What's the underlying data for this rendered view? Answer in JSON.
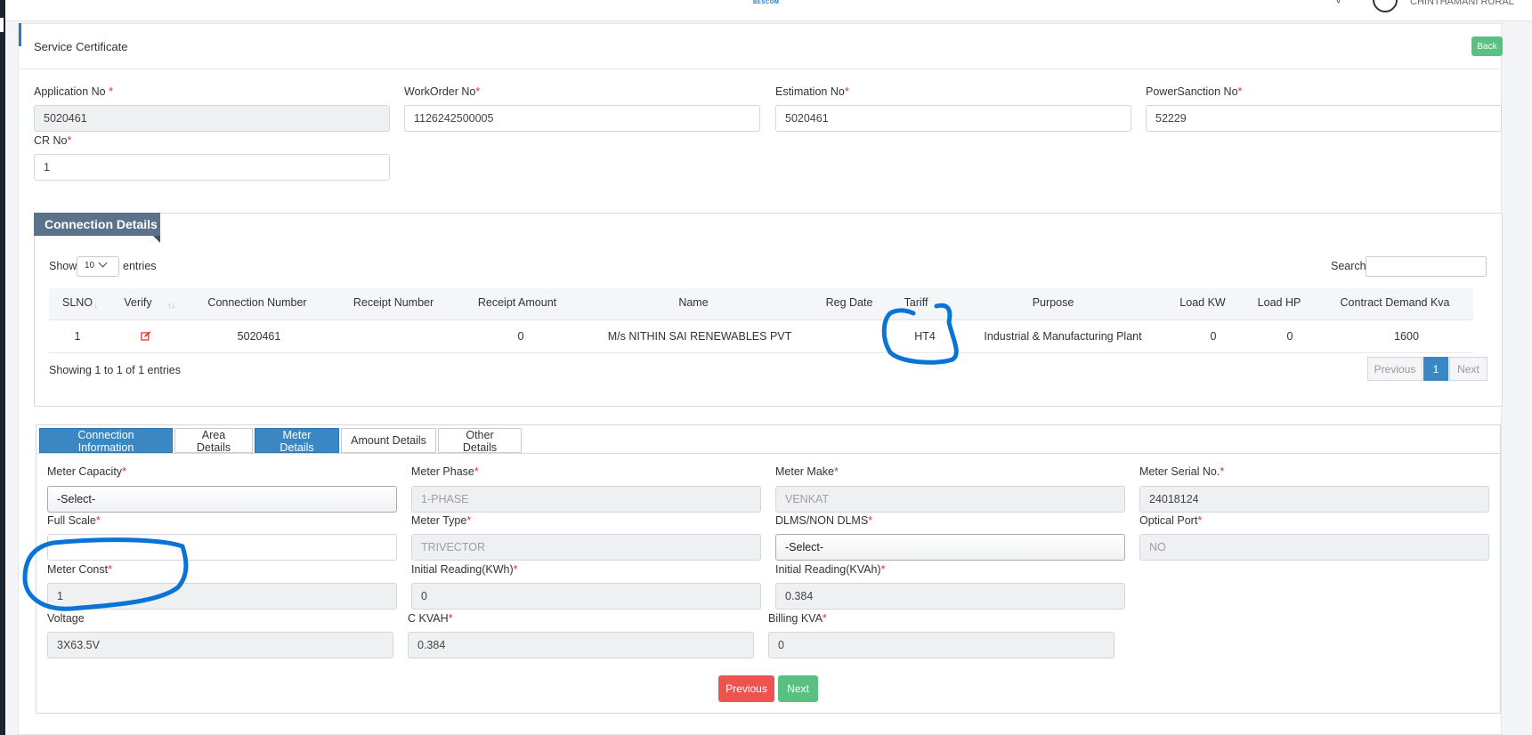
{
  "header": {
    "logo_text": "BESCOM",
    "user_name": "CHINTHAMANI RURAL"
  },
  "page": {
    "title": "Service Certificate",
    "back_label": "Back"
  },
  "form": {
    "application_no": {
      "label": "Application No",
      "required": "*",
      "value": "5020461"
    },
    "workorder_no": {
      "label": "WorkOrder No",
      "required": "*",
      "value": "1126242500005"
    },
    "estimation_no": {
      "label": "Estimation No",
      "required": "*",
      "value": "5020461"
    },
    "powersanction_no": {
      "label": "PowerSanction No",
      "required": "*",
      "value": "52229"
    },
    "cr_no": {
      "label": "CR No",
      "required": "*",
      "value": "1"
    }
  },
  "connection_details": {
    "heading": "Connection Details",
    "show_label": "Show",
    "entries_value": "10",
    "entries_label": "entries",
    "search_label": "Search:",
    "columns": [
      "SLNO",
      "Verify",
      "Connection Number",
      "Receipt Number",
      "Receipt Amount",
      "Name",
      "Reg Date",
      "Tariff",
      "Purpose",
      "Load KW",
      "Load HP",
      "Contract Demand Kva"
    ],
    "rows": [
      {
        "slno": "1",
        "connection_number": "5020461",
        "receipt_number": "",
        "receipt_amount": "0",
        "name": "M/s NITHIN SAI RENEWABLES PVT",
        "reg_date": "",
        "tariff": "HT4",
        "purpose": "Industrial & Manufacturing Plant",
        "load_kw": "0",
        "load_hp": "0",
        "contract_demand": "1600"
      }
    ],
    "showing": "Showing 1 to 1 of 1 entries",
    "pager": {
      "previous": "Previous",
      "page": "1",
      "next": "Next"
    }
  },
  "tabs": [
    "Connection Information",
    "Area Details",
    "Meter Details",
    "Amount Details",
    "Other Details"
  ],
  "meter": {
    "meter_capacity": {
      "label": "Meter Capacity",
      "required": "*",
      "value": "-Select-"
    },
    "meter_phase": {
      "label": "Meter Phase",
      "required": "*",
      "value": "1-PHASE"
    },
    "meter_make": {
      "label": "Meter Make",
      "required": "*",
      "value": "VENKAT"
    },
    "meter_serial": {
      "label": "Meter Serial No.",
      "required": "*",
      "value": "24018124"
    },
    "full_scale": {
      "label": "Full Scale",
      "required": "*",
      "value": ""
    },
    "meter_type": {
      "label": "Meter Type",
      "required": "*",
      "value": "TRIVECTOR"
    },
    "dlms": {
      "label": "DLMS/NON DLMS",
      "required": "*",
      "value": "-Select-"
    },
    "optical_port": {
      "label": "Optical Port",
      "required": "*",
      "value": "NO"
    },
    "meter_const": {
      "label": "Meter Const",
      "required": "*",
      "value": "1"
    },
    "initial_kwh": {
      "label": "Initial Reading(KWh)",
      "required": "*",
      "value": "0"
    },
    "initial_kvah": {
      "label": "Initial Reading(KVAh)",
      "required": "*",
      "value": "0.384"
    },
    "voltage": {
      "label": "Voltage",
      "required": "",
      "value": "3X63.5V"
    },
    "c_kvah": {
      "label": "C KVAH",
      "required": "*",
      "value": "0.384"
    },
    "billing_kva": {
      "label": "Billing KVA",
      "required": "*",
      "value": "0"
    }
  },
  "footer_buttons": {
    "previous": "Previous",
    "next": "Next"
  },
  "colors": {
    "primary": "#3a87c4",
    "success": "#58c182",
    "danger": "#ef5350",
    "annotation": "#0a74d6"
  },
  "icons": {
    "verify": "edit-icon",
    "sort": "sort-icon",
    "dropdown": "chevron-down-icon",
    "user": "user-icon"
  }
}
